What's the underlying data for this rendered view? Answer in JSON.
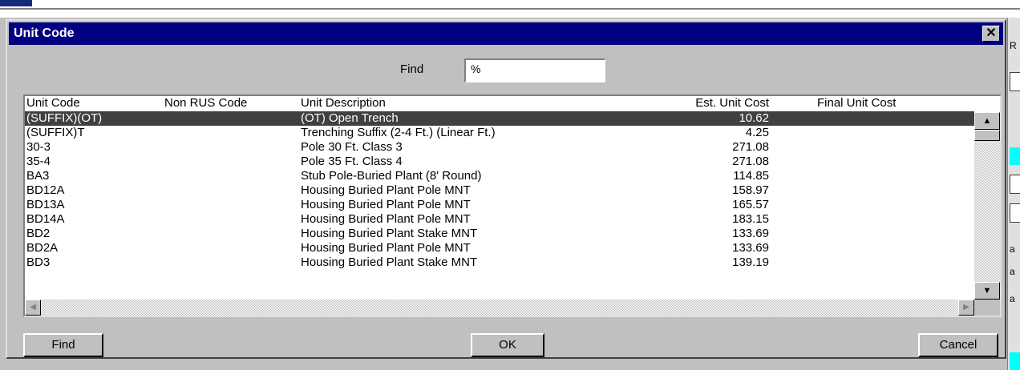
{
  "background": {
    "right_labels": [
      "R",
      "a",
      "a",
      "a"
    ]
  },
  "dialog": {
    "title": "Unit Code",
    "close_glyph": "✕",
    "find_label": "Find",
    "find_value": "%"
  },
  "list": {
    "columns": [
      "Unit Code",
      "Non RUS Code",
      "Unit Description",
      "Est. Unit Cost",
      "Final Unit Cost"
    ],
    "rows": [
      {
        "code": "(SUFFIX)(OT)",
        "nonrus": "",
        "desc": "(OT) Open Trench",
        "est": "10.62",
        "final": ""
      },
      {
        "code": "(SUFFIX)T",
        "nonrus": "",
        "desc": "Trenching Suffix (2-4 Ft.) (Linear Ft.)",
        "est": "4.25",
        "final": ""
      },
      {
        "code": "30-3",
        "nonrus": "",
        "desc": "Pole 30 Ft. Class 3",
        "est": "271.08",
        "final": ""
      },
      {
        "code": "35-4",
        "nonrus": "",
        "desc": "Pole 35 Ft. Class 4",
        "est": "271.08",
        "final": ""
      },
      {
        "code": "BA3",
        "nonrus": "",
        "desc": "Stub Pole-Buried Plant (8' Round)",
        "est": "114.85",
        "final": ""
      },
      {
        "code": "BD12A",
        "nonrus": "",
        "desc": "Housing Buried Plant Pole MNT",
        "est": "158.97",
        "final": ""
      },
      {
        "code": "BD13A",
        "nonrus": "",
        "desc": "Housing Buried Plant Pole MNT",
        "est": "165.57",
        "final": ""
      },
      {
        "code": "BD14A",
        "nonrus": "",
        "desc": "Housing Buried Plant Pole MNT",
        "est": "183.15",
        "final": ""
      },
      {
        "code": "BD2",
        "nonrus": "",
        "desc": "Housing Buried Plant Stake MNT",
        "est": "133.69",
        "final": ""
      },
      {
        "code": "BD2A",
        "nonrus": "",
        "desc": "Housing Buried Plant Pole MNT",
        "est": "133.69",
        "final": ""
      },
      {
        "code": "BD3",
        "nonrus": "",
        "desc": "Housing Buried Plant Stake MNT",
        "est": "139.19",
        "final": ""
      }
    ],
    "selected_index": 0
  },
  "buttons": {
    "find": "Find",
    "ok": "OK",
    "cancel": "Cancel"
  },
  "icons": {
    "scroll_up": "▲",
    "scroll_down": "▼",
    "scroll_left": "◀",
    "scroll_right": "▶"
  },
  "colors": {
    "title_bar": "#000080",
    "selection": "#404040",
    "window": "#c0c0c0"
  }
}
